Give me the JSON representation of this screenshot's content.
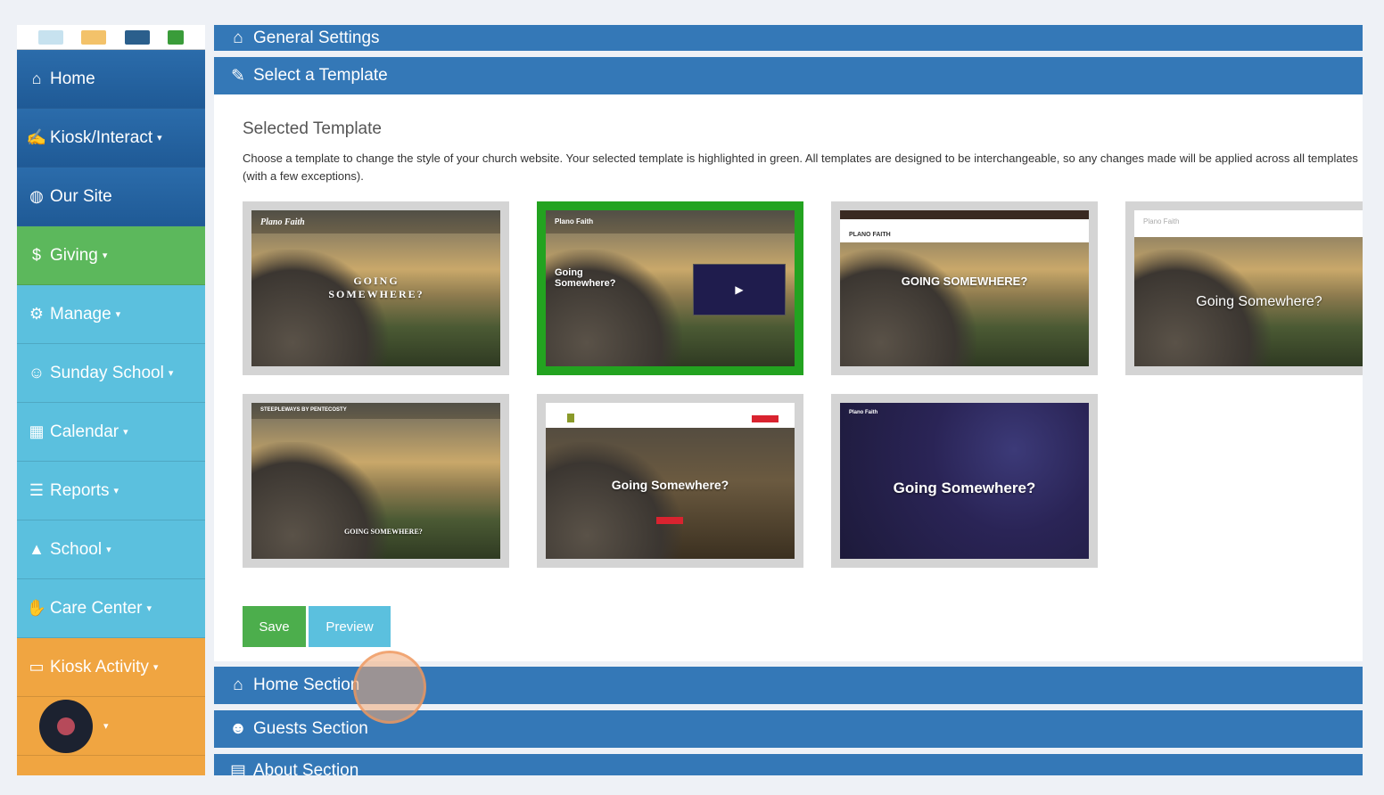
{
  "sidebar": {
    "items": [
      {
        "label": "Home",
        "icon": "home-icon",
        "color": "#2b6cab"
      },
      {
        "label": "Kiosk/Interact",
        "icon": "kiosk-icon",
        "color": "#2b6cab",
        "dropdown": true
      },
      {
        "label": "Our Site",
        "icon": "globe-icon",
        "color": "#2b6cab"
      },
      {
        "label": "Giving",
        "icon": "giving-icon",
        "color": "#5cb85c",
        "dropdown": true
      },
      {
        "label": "Manage",
        "icon": "gear-icon",
        "color": "#5bc0de",
        "dropdown": true
      },
      {
        "label": "Sunday School",
        "icon": "child-icon",
        "color": "#5bc0de",
        "dropdown": true
      },
      {
        "label": "Calendar",
        "icon": "calendar-icon",
        "color": "#5bc0de",
        "dropdown": true
      },
      {
        "label": "Reports",
        "icon": "list-icon",
        "color": "#5bc0de",
        "dropdown": true
      },
      {
        "label": "School",
        "icon": "graduation-cap-icon",
        "color": "#5bc0de",
        "dropdown": true
      },
      {
        "label": "Care Center",
        "icon": "hand-icon",
        "color": "#5bc0de",
        "dropdown": true
      },
      {
        "label": "Kiosk Activity",
        "icon": "monitor-icon",
        "color": "#f0a541",
        "dropdown": true
      }
    ]
  },
  "sections": {
    "general": "General Settings",
    "template": "Select a Template",
    "home": "Home Section",
    "guests": "Guests Section",
    "about": "About Section"
  },
  "template_panel": {
    "title": "Selected Template",
    "description": "Choose a template to change the style of your church website. Your selected template is highlighted in green. All templates are designed to be interchangeable, so any changes made will be applied across all templates (with a few exceptions).",
    "selected_color": "#23a320",
    "templates": [
      {
        "brand": "Plano Faith",
        "headline": "GOING SOMEWHERE?",
        "selected": false
      },
      {
        "brand": "Plano Faith",
        "headline": "Going Somewhere?",
        "selected": true
      },
      {
        "brand": "PLANO FAITH",
        "headline": "GOING SOMEWHERE?",
        "selected": false
      },
      {
        "brand": "Plano Faith",
        "headline": "Going Somewhere?",
        "selected": false
      },
      {
        "brand": "STEEPLEWAYS BY PENTECOSTY",
        "headline": "GOING SOMEWHERE?",
        "selected": false
      },
      {
        "brand": "",
        "headline": "Going Somewhere?",
        "selected": false
      },
      {
        "brand": "Plano Faith",
        "headline": "Going Somewhere?",
        "selected": false
      }
    ]
  },
  "buttons": {
    "save": "Save",
    "preview": "Preview"
  },
  "icons": {
    "caret": "▾",
    "home": "⌂",
    "play": "▶"
  }
}
